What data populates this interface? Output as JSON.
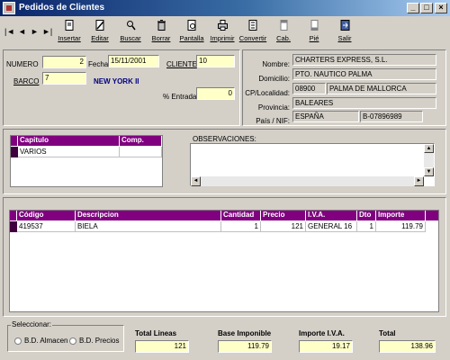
{
  "window": {
    "title": "Pedidos de Clientes"
  },
  "toolbar": {
    "nav": [
      "|◄",
      "◄",
      "►",
      "►|"
    ],
    "buttons": [
      {
        "label": "Insertar",
        "icon": "document-icon"
      },
      {
        "label": "Editar",
        "icon": "edit-icon"
      },
      {
        "label": "Buscar",
        "icon": "search-icon"
      },
      {
        "label": "Borrar",
        "icon": "trash-icon"
      },
      {
        "label": "Pantalla",
        "icon": "preview-icon"
      },
      {
        "label": "Imprimir",
        "icon": "printer-icon"
      },
      {
        "label": "Convertir",
        "icon": "convert-icon"
      },
      {
        "label": "Cab.",
        "icon": "header-icon"
      },
      {
        "label": "Pié",
        "icon": "footer-icon"
      },
      {
        "label": "Salir",
        "icon": "exit-icon"
      }
    ]
  },
  "header": {
    "numero_label": "NUMERO",
    "numero": "2",
    "fecha_label": "Fecha:",
    "fecha": "15/11/2001",
    "cliente_label": "CLIENTE",
    "cliente": "10",
    "barco_label": "BARCO",
    "barco": "7",
    "barco_name": "NEW YORK II",
    "entrada_label": "% Entrada",
    "entrada": "0"
  },
  "client": {
    "nombre_label": "Nombre:",
    "nombre": "CHARTERS EXPRESS, S.L.",
    "domicilio_label": "Domicilio:",
    "domicilio": "PTO. NAUTICO PALMA",
    "cp_label": "CP/Localidad:",
    "cp": "08900",
    "localidad": "PALMA DE MALLORCA",
    "provincia_label": "Provincia:",
    "provincia": "BALEARES",
    "pais_label": "País / NIF:",
    "pais": "ESPAÑA",
    "nif": "B-07896989"
  },
  "capitulos": {
    "headers": [
      "Capitulo",
      "Comp."
    ],
    "rows": [
      [
        "VARIOS",
        ""
      ]
    ]
  },
  "observaciones": {
    "label": "OBSERVACIONES:",
    "text": ""
  },
  "lines": {
    "headers": [
      "Código",
      "Descripcion",
      "Cantidad",
      "Precio",
      "I.V.A.",
      "Dto",
      "Importe"
    ],
    "rows": [
      [
        "419537",
        "BIELA",
        "1",
        "121",
        "GENERAL 16",
        "1",
        "119.79"
      ]
    ]
  },
  "selector": {
    "label": "Seleccionar:",
    "options": [
      "B.D. Almacen",
      "B.D. Precios"
    ]
  },
  "totals": {
    "total_lineas_label": "Total Lineas",
    "total_lineas": "121",
    "base_label": "Base Imponible",
    "base": "119.79",
    "iva_label": "Importe I.V.A.",
    "iva": "19.17",
    "total_label": "Total",
    "total": "138.96"
  }
}
